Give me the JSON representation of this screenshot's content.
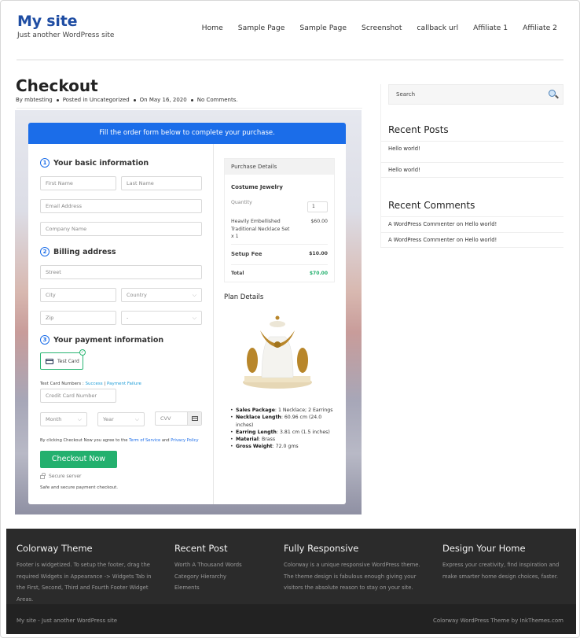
{
  "site": {
    "title": "My site",
    "tagline": "Just another WordPress site"
  },
  "nav": {
    "items": [
      "Home",
      "Sample Page",
      "Sample Page",
      "Screenshot",
      "callback url",
      "Affiliate 1",
      "Affiliate 2"
    ]
  },
  "post": {
    "title": "Checkout",
    "meta": {
      "author": "By mbtesting",
      "category": "Posted in Uncategorized",
      "date": "On May 16, 2020",
      "comments": "No Comments."
    }
  },
  "checkout": {
    "banner": "Fill the order form below to complete your purchase.",
    "sections": {
      "basic": {
        "num": "1",
        "label": "Your basic information"
      },
      "billing": {
        "num": "2",
        "label": "Billing address"
      },
      "payment": {
        "num": "3",
        "label": "Your payment information"
      }
    },
    "fields": {
      "first_name": "First Name",
      "last_name": "Last Name",
      "email": "Email Address",
      "company": "Company Name",
      "street": "Street",
      "city": "City",
      "country": "Country",
      "zip": "Zip",
      "state": "-",
      "card_number": "Credit Card Number",
      "month": "Month",
      "year": "Year",
      "cvv": "CVV"
    },
    "payment_method": "Test Card",
    "test_cards": {
      "label": "Test Card Numbers : ",
      "success": "Success",
      "separator": " | ",
      "failure": "Payment Failure"
    },
    "terms": {
      "prefix": "By clicking Checkout Now you agree to the ",
      "tos": "Term of Service",
      "and": " and ",
      "privacy": "Privacy Policy"
    },
    "button": "Checkout Now",
    "secure": "Secure server",
    "safe": "Safe and secure payment checkout."
  },
  "purchase": {
    "heading": "Purchase Details",
    "product": "Costume Jewelry",
    "quantity_label": "Quantity",
    "quantity": "1",
    "item_line1": "Heavily Embellished",
    "item_line2": "Traditional Necklace Set",
    "item_line3": "x 1",
    "item_price": "$60.00",
    "setup_label": "Setup Fee",
    "setup_price": "$10.00",
    "total_label": "Total",
    "total_price": "$70.00",
    "total_color": "#23b06e"
  },
  "plan": {
    "heading": "Plan Details",
    "specs": [
      {
        "key": "Sales Package",
        "val": ": 1 Necklace; 2 Earrings"
      },
      {
        "key": "Necklace Length",
        "val": ": 60.96 cm (24.0 inches)"
      },
      {
        "key": "Earring Length",
        "val": ": 3.81 cm (1.5 inches)"
      },
      {
        "key": "Material",
        "val": ": Brass"
      },
      {
        "key": "Gross Weight",
        "val": ": 72.0 gms"
      }
    ]
  },
  "sidebar": {
    "search_placeholder": "Search",
    "recent_posts_heading": "Recent Posts",
    "recent_posts": [
      "Hello world!",
      "Hello world!"
    ],
    "recent_comments_heading": "Recent Comments",
    "recent_comments": [
      {
        "author": "A WordPress Commenter",
        "on": " on ",
        "post": "Hello world!"
      },
      {
        "author": "A WordPress Commenter",
        "on": " on ",
        "post": "Hello world!"
      }
    ]
  },
  "footer": {
    "col1": {
      "heading": "Colorway Theme",
      "text": "Footer is widgetized. To setup the footer, drag the required Widgets in Appearance -> Widgets Tab in the First, Second, Third and Fourth Footer Widget Areas."
    },
    "col2": {
      "heading": "Recent Post",
      "links": [
        "Worth A Thousand Words",
        "Category Hierarchy",
        "Elements"
      ]
    },
    "col3": {
      "heading": "Fully Responsive",
      "text": "Colorway is a unique responsive WordPress theme. The theme design is fabulous enough giving your visitors the absolute reason to stay on your site."
    },
    "col4": {
      "heading": "Design Your Home",
      "text": "Express your creativity, find inspiration and make smarter home design choices, faster."
    },
    "bottom_left": "My site - Just another WordPress site",
    "bottom_right": "Colorway WordPress Theme by InkThemes.com"
  },
  "colors": {
    "brand": "#1f4da3",
    "banner": "#1b6de9",
    "cta": "#23b06e",
    "link": "#1b9bd7"
  }
}
